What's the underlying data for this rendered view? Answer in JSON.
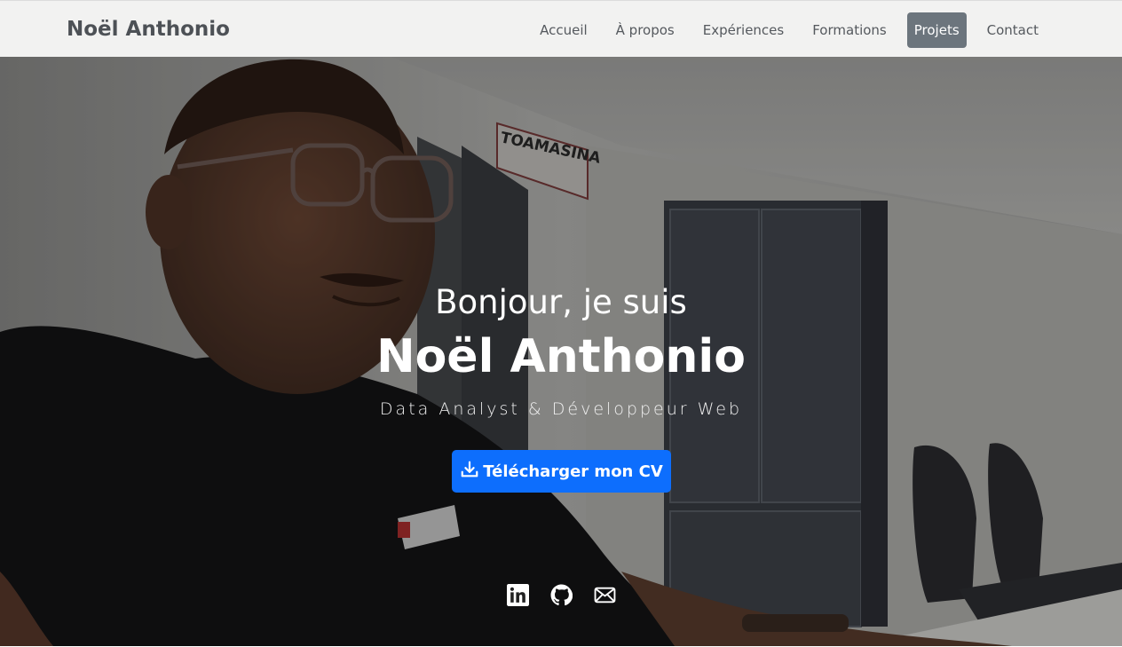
{
  "navbar": {
    "brand": "Noël Anthonio",
    "links": [
      {
        "label": "Accueil"
      },
      {
        "label": "À propos"
      },
      {
        "label": "Expériences"
      },
      {
        "label": "Formations"
      },
      {
        "label": "Projets",
        "active": true
      },
      {
        "label": "Contact"
      }
    ]
  },
  "hero": {
    "greeting": "Bonjour, je suis",
    "name": "Noël Anthonio",
    "subtitle": "Data Analyst & Développeur Web",
    "cv_button": {
      "label": "Télécharger mon CV",
      "icon": "download-icon"
    },
    "wall_sign": "TOAMASINA",
    "socials": [
      {
        "icon": "linkedin-icon"
      },
      {
        "icon": "github-icon"
      },
      {
        "icon": "envelope-icon"
      }
    ]
  },
  "colors": {
    "primary": "#0d6efd",
    "nav_active_bg": "#6c757d",
    "nav_bg": "#f2f2f1",
    "brand_text": "#4d5156"
  }
}
